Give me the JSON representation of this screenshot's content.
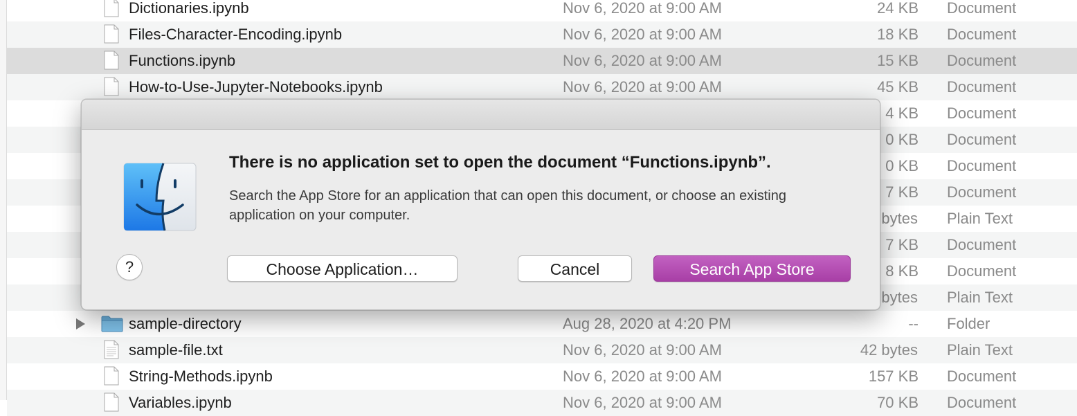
{
  "file_list": {
    "rows": [
      {
        "name": "Dictionaries.ipynb",
        "date": "Nov 6, 2020 at 9:00 AM",
        "size": "24 KB",
        "kind": "Document",
        "icon": "document-icon"
      },
      {
        "name": "Files-Character-Encoding.ipynb",
        "date": "Nov 6, 2020 at 9:00 AM",
        "size": "18 KB",
        "kind": "Document",
        "icon": "document-icon"
      },
      {
        "name": "Functions.ipynb",
        "date": "Nov 6, 2020 at 9:00 AM",
        "size": "15 KB",
        "kind": "Document",
        "icon": "document-icon",
        "selected": true
      },
      {
        "name": "How-to-Use-Jupyter-Notebooks.ipynb",
        "date": "Nov 6, 2020 at 9:00 AM",
        "size": "45 KB",
        "kind": "Document",
        "icon": "document-icon"
      },
      {
        "name": "",
        "date": "",
        "size": "4 KB",
        "kind": "Document"
      },
      {
        "name": "",
        "date": "",
        "size": "0 KB",
        "kind": "Document"
      },
      {
        "name": "",
        "date": "",
        "size": "0 KB",
        "kind": "Document"
      },
      {
        "name": "",
        "date": "",
        "size": "7 KB",
        "kind": "Document"
      },
      {
        "name": "",
        "date": "",
        "size": "bytes",
        "kind": "Plain Text"
      },
      {
        "name": "",
        "date": "",
        "size": "7 KB",
        "kind": "Document"
      },
      {
        "name": "",
        "date": "",
        "size": "8 KB",
        "kind": "Document"
      },
      {
        "name": "",
        "date": "",
        "size": "bytes",
        "kind": "Plain Text"
      },
      {
        "name": "sample-directory",
        "date": "Aug 28, 2020 at 4:20 PM",
        "size": "--",
        "kind": "Folder",
        "icon": "folder-icon"
      },
      {
        "name": "sample-file.txt",
        "date": "Nov 6, 2020 at 9:00 AM",
        "size": "42 bytes",
        "kind": "Plain Text",
        "icon": "text-file-icon"
      },
      {
        "name": "String-Methods.ipynb",
        "date": "Nov 6, 2020 at 9:00 AM",
        "size": "157 KB",
        "kind": "Document",
        "icon": "document-icon"
      },
      {
        "name": "Variables.ipynb",
        "date": "Nov 6, 2020 at 9:00 AM",
        "size": "70 KB",
        "kind": "Document",
        "icon": "document-icon"
      }
    ]
  },
  "dialog": {
    "title": "There is no application set to open the document “Functions.ipynb”.",
    "body": "Search the App Store for an application that can open this document, or choose an existing application on your computer.",
    "help_label": "?",
    "choose_label": "Choose Application…",
    "cancel_label": "Cancel",
    "search_label": "Search App Store",
    "accent_color": "#b24fb0"
  }
}
